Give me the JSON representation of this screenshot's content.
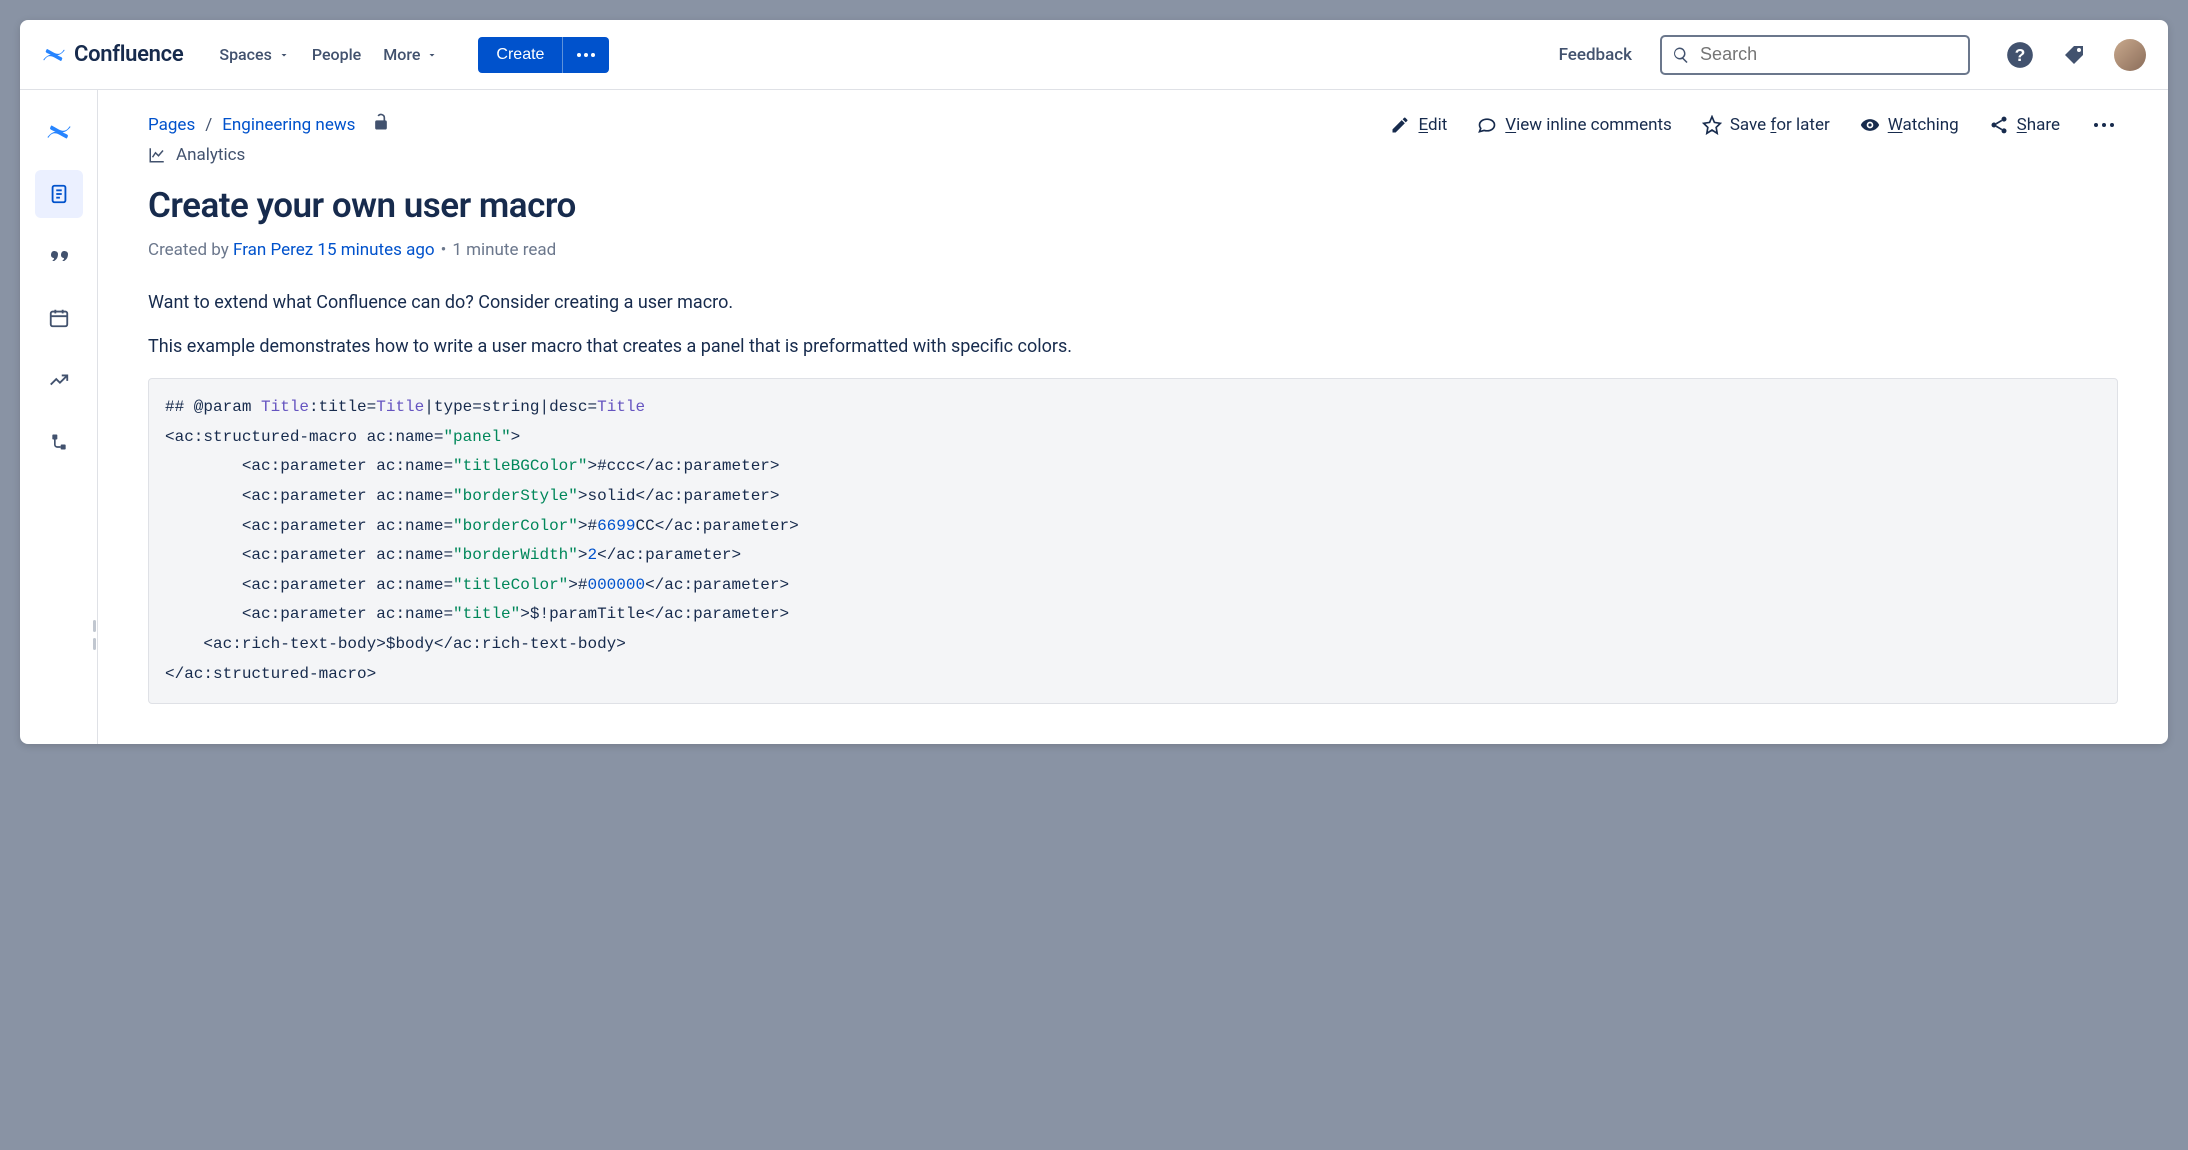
{
  "brand": {
    "name": "Confluence"
  },
  "nav": {
    "spaces": "Spaces",
    "people": "People",
    "more": "More",
    "create": "Create",
    "feedback": "Feedback"
  },
  "search": {
    "placeholder": "Search"
  },
  "breadcrumb": {
    "pages": "Pages",
    "space": "Engineering news"
  },
  "actions": {
    "edit": "Edit",
    "edit_rest": "dit",
    "view_comments": "View inline comments",
    "view_rest": "iew inline comments",
    "save": "Save for later",
    "save_pre": "Save ",
    "save_mid": "f",
    "save_post": "or later",
    "watching": "Watching",
    "watching_rest": "atching",
    "share": "Share",
    "share_rest": "hare",
    "analytics": "Analytics"
  },
  "page": {
    "title": "Create your own user macro",
    "byline_prefix": "Created by ",
    "author": "Fran Perez",
    "age": "15 minutes ago",
    "read_time": "1 minute read"
  },
  "body": {
    "p1": "Want to extend what Confluence can do? Consider creating a user macro.",
    "p2": "This example demonstrates how to write a user macro that creates a panel that is preformatted with specific colors."
  },
  "code": {
    "l1_a": "## @param ",
    "l1_kw1": "Title",
    "l1_b": ":title=",
    "l1_kw2": "Title",
    "l1_c": "|type=string|desc=",
    "l1_kw3": "Title",
    "l2_a": "<ac:structured-macro ac:name=",
    "l2_s": "\"panel\"",
    "l2_b": ">",
    "l3_a": "        <ac:parameter ac:name=",
    "l3_s": "\"titleBGColor\"",
    "l3_b": ">#ccc</ac:parameter>",
    "l4_a": "        <ac:parameter ac:name=",
    "l4_s": "\"borderStyle\"",
    "l4_b": ">solid</ac:parameter>",
    "l5_a": "        <ac:parameter ac:name=",
    "l5_s": "\"borderColor\"",
    "l5_b": ">#",
    "l5_n": "6699",
    "l5_c": "CC</ac:parameter>",
    "l6_a": "        <ac:parameter ac:name=",
    "l6_s": "\"borderWidth\"",
    "l6_b": ">",
    "l6_n": "2",
    "l6_c": "</ac:parameter>",
    "l7_a": "        <ac:parameter ac:name=",
    "l7_s": "\"titleColor\"",
    "l7_b": ">#",
    "l7_n": "000000",
    "l7_c": "</ac:parameter>",
    "l8_a": "        <ac:parameter ac:name=",
    "l8_s": "\"title\"",
    "l8_b": ">$!paramTitle</ac:parameter>",
    "l9": "    <ac:rich-text-body>$body</ac:rich-text-body>",
    "l10": "</ac:structured-macro>"
  }
}
